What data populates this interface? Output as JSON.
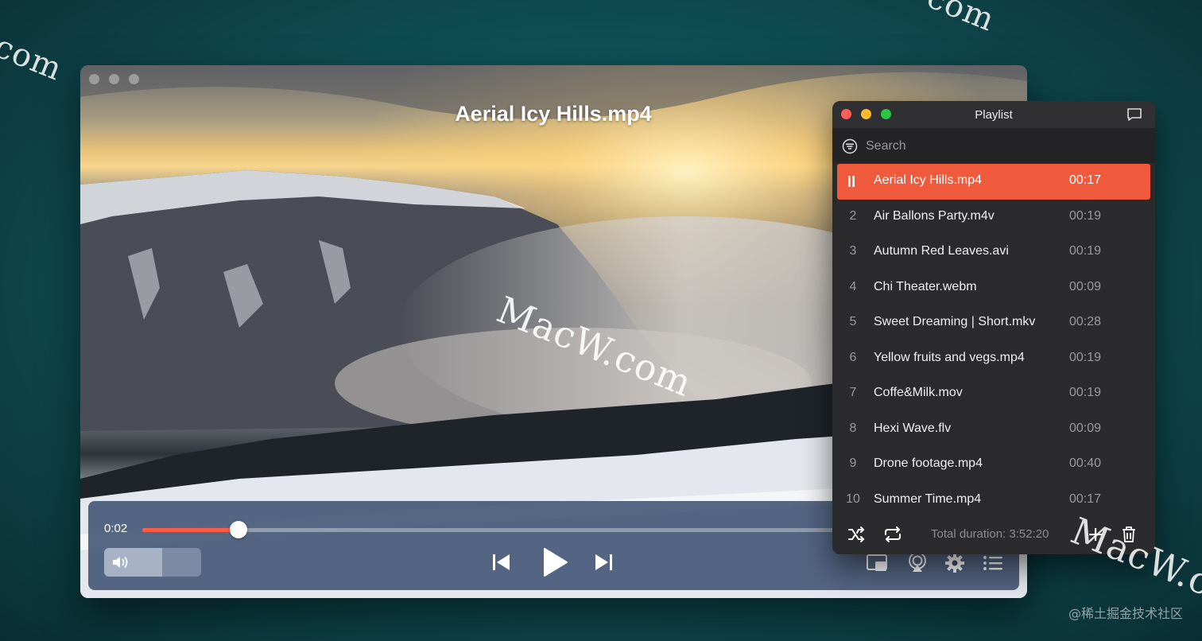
{
  "player": {
    "title": "Aerial Icy Hills.mp4",
    "current_time": "0:02",
    "progress_fraction": 0.11,
    "volume_fraction": 0.6
  },
  "playlist": {
    "title": "Playlist",
    "search_placeholder": "Search",
    "active_index": 0,
    "items": [
      {
        "num": "",
        "name": "Aerial Icy Hills.mp4",
        "duration": "00:17"
      },
      {
        "num": "2",
        "name": "Air Ballons Party.m4v",
        "duration": "00:19"
      },
      {
        "num": "3",
        "name": "Autumn Red Leaves.avi",
        "duration": "00:19"
      },
      {
        "num": "4",
        "name": "Chi Theater.webm",
        "duration": "00:09"
      },
      {
        "num": "5",
        "name": "Sweet Dreaming | Short.mkv",
        "duration": "00:28"
      },
      {
        "num": "6",
        "name": "Yellow fruits and vegs.mp4",
        "duration": "00:19"
      },
      {
        "num": "7",
        "name": "Coffe&Milk.mov",
        "duration": "00:19"
      },
      {
        "num": "8",
        "name": "Hexi Wave.flv",
        "duration": "00:09"
      },
      {
        "num": "9",
        "name": "Drone footage.mp4",
        "duration": "00:40"
      },
      {
        "num": "10",
        "name": "Summer Time.mp4",
        "duration": "00:17"
      }
    ],
    "total_duration": "Total duration: 3:52:20"
  },
  "watermarks": {
    "top_left": "com",
    "top_right": "com",
    "center": "MacW.com",
    "bottom_right": "MacW.c"
  },
  "credit": "@稀土掘金技术社区",
  "colors": {
    "accent": "#f05a3c",
    "progress": "#ff5b45",
    "panel": "#2b2b2d",
    "controls": "#3a4e6e"
  },
  "icons": [
    "speaker-icon",
    "previous-icon",
    "play-icon",
    "next-icon",
    "pip-icon",
    "airplay-icon",
    "gear-icon",
    "list-icon",
    "filter-icon",
    "chat-icon",
    "pause-icon",
    "shuffle-icon",
    "repeat-icon",
    "plus-icon",
    "trash-icon"
  ]
}
